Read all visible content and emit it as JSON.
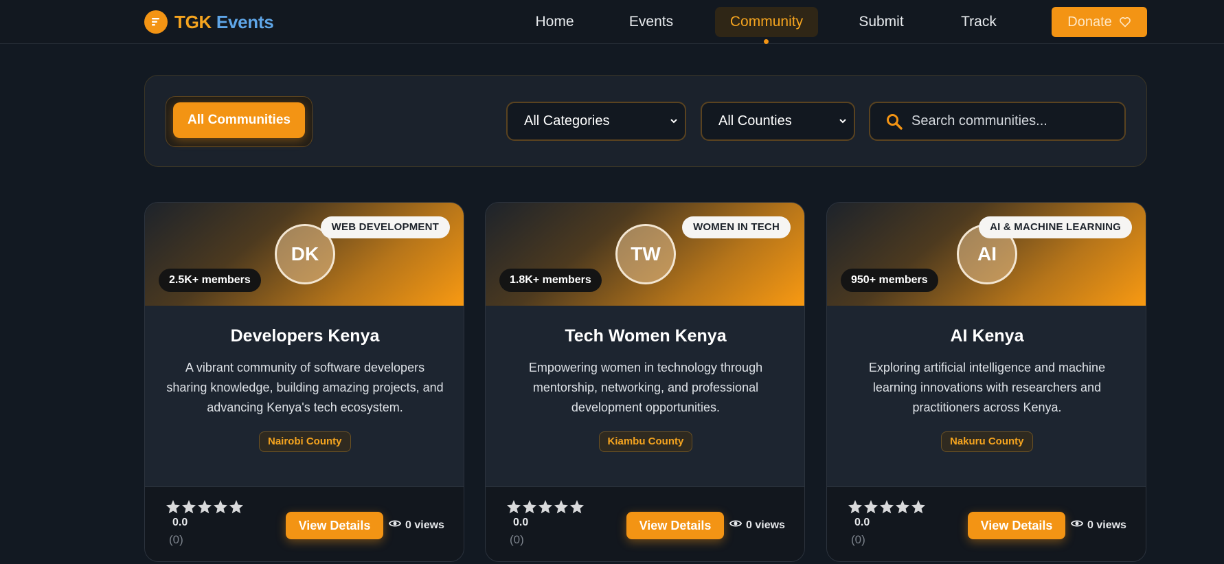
{
  "brand": {
    "part1": "TGK",
    "part2": "Events"
  },
  "nav": {
    "links": [
      "Home",
      "Events",
      "Community",
      "Submit",
      "Track"
    ],
    "donate": "Donate"
  },
  "filters": {
    "all_communities": "All Communities",
    "category_select": "All Categories",
    "county_select": "All Counties",
    "search_placeholder": "Search communities..."
  },
  "cards": [
    {
      "initials": "DK",
      "category": "WEB DEVELOPMENT",
      "members": "2.5K+ members",
      "title": "Developers Kenya",
      "description": "A vibrant community of software developers sharing knowledge, building amazing projects, and advancing Kenya's tech ecosystem.",
      "county": "Nairobi County",
      "rating": "0.0",
      "rating_count": "(0)",
      "view_label": "View Details",
      "views": "0 views"
    },
    {
      "initials": "TW",
      "category": "WOMEN IN TECH",
      "members": "1.8K+ members",
      "title": "Tech Women Kenya",
      "description": "Empowering women in technology through mentorship, networking, and professional development opportunities.",
      "county": "Kiambu County",
      "rating": "0.0",
      "rating_count": "(0)",
      "view_label": "View Details",
      "views": "0 views"
    },
    {
      "initials": "AI",
      "category": "AI & MACHINE LEARNING",
      "members": "950+ members",
      "title": "AI Kenya",
      "description": "Exploring artificial intelligence and machine learning innovations with researchers and practitioners across Kenya.",
      "county": "Nakuru County",
      "rating": "0.0",
      "rating_count": "(0)",
      "view_label": "View Details",
      "views": "0 views"
    }
  ],
  "colors": {
    "accent": "#f39414",
    "background": "#121922",
    "card": "#1d2530"
  },
  "icons": [
    "logo-icon",
    "heart-icon",
    "chevron-down-icon",
    "search-icon",
    "star-icon",
    "eye-icon"
  ]
}
